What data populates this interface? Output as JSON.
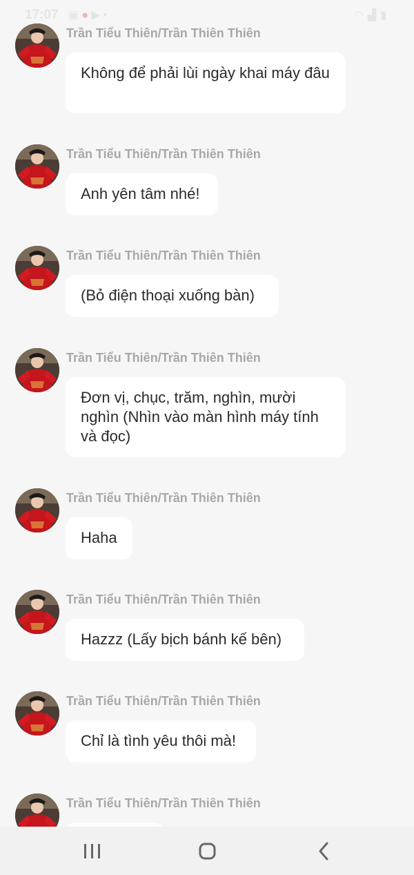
{
  "status_bar": {
    "time": "17:07",
    "left_icons": [
      "image-icon",
      "fruit-icon",
      "video-icon",
      "dot-icon"
    ],
    "right_icons": [
      "wifi-icon",
      "signal-icon",
      "battery-icon"
    ]
  },
  "messages": [
    {
      "sender": "Trần Tiểu Thiên/Trần Thiên Thiên",
      "text": "Không để phải lùi ngày khai máy đâu"
    },
    {
      "sender": "Trần Tiểu Thiên/Trần Thiên Thiên",
      "text": "Anh yên tâm nhé!"
    },
    {
      "sender": "Trần Tiểu Thiên/Trần Thiên Thiên",
      "text": "(Bỏ điện thoại xuống bàn)"
    },
    {
      "sender": "Trần Tiểu Thiên/Trần Thiên Thiên",
      "text": "Đơn vị, chục, trăm, nghìn, mười nghìn (Nhìn vào màn hình máy tính và đọc)"
    },
    {
      "sender": "Trần Tiểu Thiên/Trần Thiên Thiên",
      "text": "Haha"
    },
    {
      "sender": "Trần Tiểu Thiên/Trần Thiên Thiên",
      "text": "Hazzz (Lấy bịch bánh kế bên)"
    },
    {
      "sender": "Trần Tiểu Thiên/Trần Thiên Thiên",
      "text": "Chỉ là tình yêu thôi mà!"
    },
    {
      "sender": "Trần Tiểu Thiên/Trần Thiên Thiên",
      "text": ""
    }
  ],
  "nav_bar": {
    "buttons": [
      "recent-apps-icon",
      "home-icon",
      "back-icon"
    ]
  }
}
